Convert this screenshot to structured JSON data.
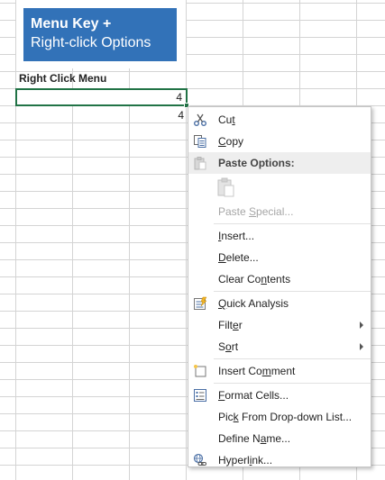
{
  "title_box": {
    "line1": "Menu Key +",
    "line2": "Right-click Options",
    "color": "#3272b8"
  },
  "sheet": {
    "label": "Right Click Menu",
    "active_value": "4",
    "below_value": "4",
    "selection_color": "#217346"
  },
  "menu": {
    "cut": {
      "pre": "Cu",
      "key": "t",
      "post": "",
      "icon": "scissors-icon"
    },
    "copy": {
      "pre": "",
      "key": "C",
      "post": "opy",
      "icon": "copy-icon"
    },
    "paste_options": {
      "label": "Paste Options:",
      "icon": "clipboard-icon"
    },
    "paste_special": {
      "pre": "Paste ",
      "key": "S",
      "post": "pecial...",
      "disabled": true
    },
    "insert": {
      "pre": "",
      "key": "I",
      "post": "nsert..."
    },
    "delete": {
      "pre": "",
      "key": "D",
      "post": "elete..."
    },
    "clear_contents": {
      "pre": "Clear Co",
      "key": "n",
      "post": "tents"
    },
    "quick_analysis": {
      "pre": "",
      "key": "Q",
      "post": "uick Analysis",
      "icon": "quick-analysis-icon"
    },
    "filter": {
      "pre": "Filt",
      "key": "e",
      "post": "r"
    },
    "sort": {
      "pre": "S",
      "key": "o",
      "post": "rt"
    },
    "insert_comment": {
      "pre": "Insert Co",
      "key": "m",
      "post": "ment",
      "icon": "comment-icon"
    },
    "format_cells": {
      "pre": "",
      "key": "F",
      "post": "ormat Cells...",
      "icon": "format-cells-icon"
    },
    "pick_list": {
      "pre": "Pic",
      "key": "k",
      "post": " From Drop-down List..."
    },
    "define_name": {
      "pre": "Define N",
      "key": "a",
      "post": "me..."
    },
    "hyperlink": {
      "pre": "Hyperl",
      "key": "i",
      "post": "nk...",
      "icon": "hyperlink-icon"
    }
  }
}
